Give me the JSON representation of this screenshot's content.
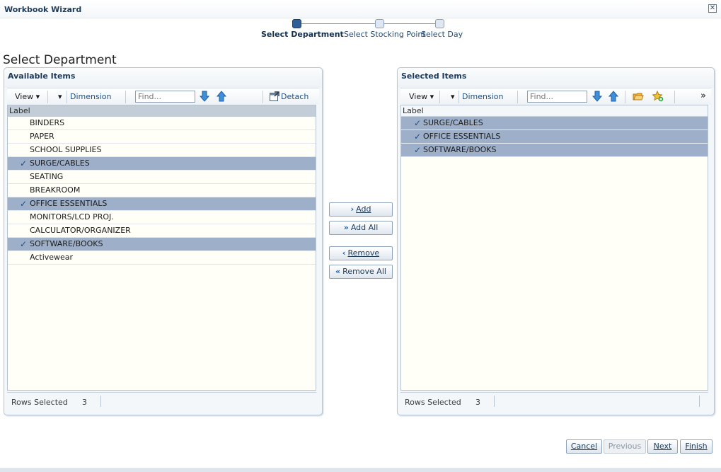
{
  "window": {
    "title": "Workbook Wizard",
    "close_glyph": "✕"
  },
  "train": {
    "stops": [
      {
        "label": "Select Department",
        "current": true
      },
      {
        "label": "Select Stocking Point",
        "current": false
      },
      {
        "label": "Select Day",
        "current": false
      }
    ]
  },
  "page_title": "Select Department",
  "available": {
    "title": "Available Items",
    "toolbar": {
      "view": "View",
      "view_caret": "▾",
      "dim_caret": "▾",
      "dimension": "Dimension",
      "find_placeholder": "Find...",
      "detach": "Detach"
    },
    "column": "Label",
    "rows": [
      {
        "label": "BINDERS",
        "selected": false
      },
      {
        "label": "PAPER",
        "selected": false
      },
      {
        "label": "SCHOOL SUPPLIES",
        "selected": false
      },
      {
        "label": "SURGE/CABLES",
        "selected": true
      },
      {
        "label": "SEATING",
        "selected": false
      },
      {
        "label": "BREAKROOM",
        "selected": false
      },
      {
        "label": "OFFICE ESSENTIALS",
        "selected": true
      },
      {
        "label": "MONITORS/LCD PROJ.",
        "selected": false
      },
      {
        "label": "CALCULATOR/ORGANIZER",
        "selected": false
      },
      {
        "label": "SOFTWARE/BOOKS",
        "selected": true
      },
      {
        "label": "Activewear",
        "selected": false
      }
    ],
    "status": {
      "label": "Rows Selected",
      "count": "3"
    }
  },
  "selected": {
    "title": "Selected Items",
    "toolbar": {
      "view": "View",
      "view_caret": "▾",
      "dim_caret": "▾",
      "dimension": "Dimension",
      "find_placeholder": "Find...",
      "more": "»"
    },
    "column": "Label",
    "rows": [
      {
        "label": "SURGE/CABLES",
        "selected": true
      },
      {
        "label": "OFFICE ESSENTIALS",
        "selected": true
      },
      {
        "label": "SOFTWARE/BOOKS",
        "selected": true
      }
    ],
    "status": {
      "label": "Rows Selected",
      "count": "3"
    }
  },
  "shuttle": {
    "add": "Add",
    "add_all": "Add All",
    "remove": "Remove",
    "remove_all": "Remove All",
    "add_glyph": "›",
    "add_all_glyph": "»",
    "remove_glyph": "‹",
    "remove_all_glyph": "«"
  },
  "buttons": {
    "cancel": "Cancel",
    "previous": "Previous",
    "next": "Next",
    "finish": "Finish"
  },
  "check_glyph": "✓",
  "colors": {
    "accent": "#1f4f82",
    "selected_row": "#9eb0c9",
    "train_current": "#2e5f96"
  }
}
